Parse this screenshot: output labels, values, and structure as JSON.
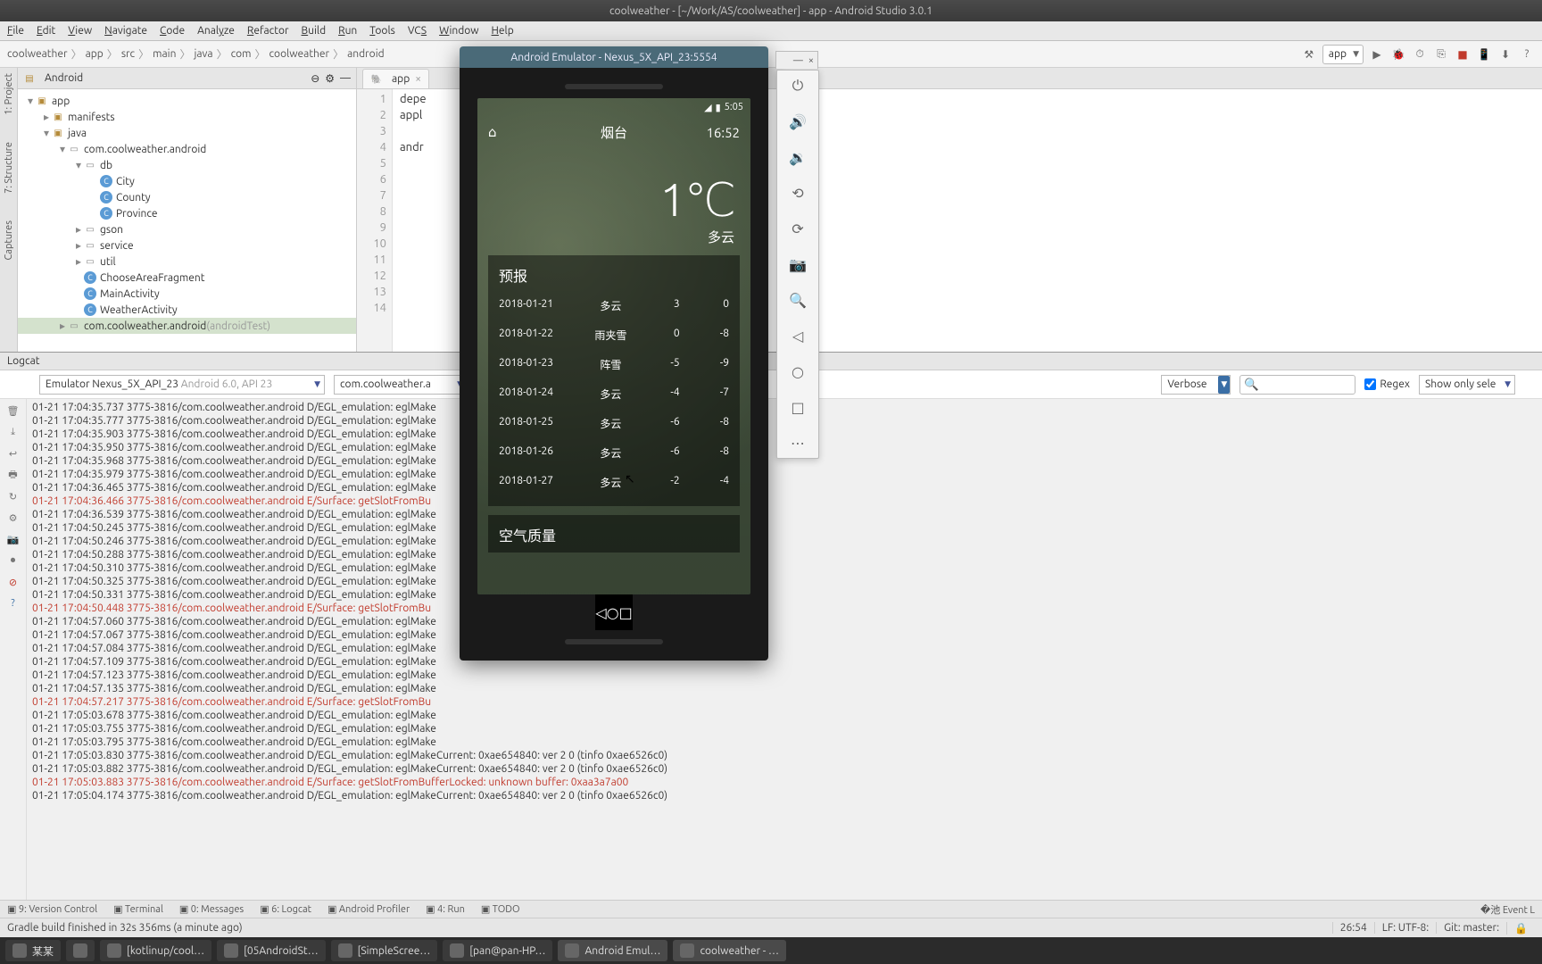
{
  "window_title": "coolweather - [~/Work/AS/coolweather] - app - Android Studio 3.0.1",
  "menu": [
    "File",
    "Edit",
    "View",
    "Navigate",
    "Code",
    "Analyze",
    "Refactor",
    "Build",
    "Run",
    "Tools",
    "VCS",
    "Window",
    "Help"
  ],
  "menu_mnemonic_index": [
    0,
    0,
    0,
    0,
    0,
    4,
    0,
    0,
    0,
    0,
    2,
    0,
    0
  ],
  "breadcrumbs": [
    "coolweather",
    "app",
    "src",
    "main",
    "java",
    "com",
    "coolweather",
    "android"
  ],
  "run_config": "app",
  "proj_scope": "Android",
  "project_tree": [
    {
      "d": 0,
      "t": "app",
      "tw": "▾",
      "ic": "fold"
    },
    {
      "d": 1,
      "t": "manifests",
      "tw": "▸",
      "ic": "fold"
    },
    {
      "d": 1,
      "t": "java",
      "tw": "▾",
      "ic": "fold"
    },
    {
      "d": 2,
      "t": "com.coolweather.android",
      "tw": "▾",
      "ic": "pkg"
    },
    {
      "d": 3,
      "t": "db",
      "tw": "▾",
      "ic": "pkg"
    },
    {
      "d": 4,
      "t": "City",
      "tw": " ",
      "ic": "cls"
    },
    {
      "d": 4,
      "t": "County",
      "tw": " ",
      "ic": "cls"
    },
    {
      "d": 4,
      "t": "Province",
      "tw": " ",
      "ic": "cls"
    },
    {
      "d": 3,
      "t": "gson",
      "tw": "▸",
      "ic": "pkg"
    },
    {
      "d": 3,
      "t": "service",
      "tw": "▸",
      "ic": "pkg"
    },
    {
      "d": 3,
      "t": "util",
      "tw": "▸",
      "ic": "pkg"
    },
    {
      "d": 3,
      "t": "ChooseAreaFragment",
      "tw": " ",
      "ic": "cls"
    },
    {
      "d": 3,
      "t": "MainActivity",
      "tw": " ",
      "ic": "cls"
    },
    {
      "d": 3,
      "t": "WeatherActivity",
      "tw": " ",
      "ic": "cls"
    },
    {
      "d": 2,
      "t": "com.coolweather.android",
      "suff": " (androidTest)",
      "tw": "▸",
      "ic": "pkg",
      "sel": true
    }
  ],
  "editor_tab": "app",
  "gutter_lines": [
    "1",
    "2",
    "3",
    "4",
    "5",
    "6",
    "7",
    "8",
    "9",
    "10",
    "11",
    "12",
    "13",
    "14"
  ],
  "src_lines": [
    "depe",
    "appl",
    "",
    "andr",
    "",
    "",
    "",
    "",
    "",
    "",
    "",
    "",
    "",
    ""
  ],
  "logcat_label": "Logcat",
  "logcat_device": "Emulator Nexus_5X_API_23",
  "logcat_device_suffix": "Android 6.0, API 23",
  "logcat_process": "com.coolweather.a",
  "logcat_level": "Verbose",
  "logcat_search_placeholder": "",
  "logcat_regex": "Regex",
  "logcat_filter": "Show only sele",
  "log_lines": [
    {
      "t": "01-21 17:04:35.737 3775-3816/com.coolweather.android D/EGL_emulation: eglMake"
    },
    {
      "t": "01-21 17:04:35.777 3775-3816/com.coolweather.android D/EGL_emulation: eglMake"
    },
    {
      "t": "01-21 17:04:35.903 3775-3816/com.coolweather.android D/EGL_emulation: eglMake"
    },
    {
      "t": "01-21 17:04:35.950 3775-3816/com.coolweather.android D/EGL_emulation: eglMake"
    },
    {
      "t": "01-21 17:04:35.968 3775-3816/com.coolweather.android D/EGL_emulation: eglMake"
    },
    {
      "t": "01-21 17:04:35.979 3775-3816/com.coolweather.android D/EGL_emulation: eglMake"
    },
    {
      "t": "01-21 17:04:36.465 3775-3816/com.coolweather.android D/EGL_emulation: eglMake"
    },
    {
      "t": "01-21 17:04:36.466 3775-3816/com.coolweather.android E/Surface: getSlotFromBu",
      "err": true
    },
    {
      "t": "01-21 17:04:36.539 3775-3816/com.coolweather.android D/EGL_emulation: eglMake"
    },
    {
      "t": "01-21 17:04:50.245 3775-3816/com.coolweather.android D/EGL_emulation: eglMake"
    },
    {
      "t": "01-21 17:04:50.246 3775-3816/com.coolweather.android D/EGL_emulation: eglMake"
    },
    {
      "t": "01-21 17:04:50.288 3775-3816/com.coolweather.android D/EGL_emulation: eglMake"
    },
    {
      "t": "01-21 17:04:50.310 3775-3816/com.coolweather.android D/EGL_emulation: eglMake"
    },
    {
      "t": "01-21 17:04:50.325 3775-3816/com.coolweather.android D/EGL_emulation: eglMake"
    },
    {
      "t": "01-21 17:04:50.331 3775-3816/com.coolweather.android D/EGL_emulation: eglMake"
    },
    {
      "t": "01-21 17:04:50.448 3775-3816/com.coolweather.android E/Surface: getSlotFromBu",
      "err": true
    },
    {
      "t": "01-21 17:04:57.060 3775-3816/com.coolweather.android D/EGL_emulation: eglMake"
    },
    {
      "t": "01-21 17:04:57.067 3775-3816/com.coolweather.android D/EGL_emulation: eglMake"
    },
    {
      "t": "01-21 17:04:57.084 3775-3816/com.coolweather.android D/EGL_emulation: eglMake"
    },
    {
      "t": "01-21 17:04:57.109 3775-3816/com.coolweather.android D/EGL_emulation: eglMake"
    },
    {
      "t": "01-21 17:04:57.123 3775-3816/com.coolweather.android D/EGL_emulation: eglMake"
    },
    {
      "t": "01-21 17:04:57.135 3775-3816/com.coolweather.android D/EGL_emulation: eglMake"
    },
    {
      "t": "01-21 17:04:57.217 3775-3816/com.coolweather.android E/Surface: getSlotFromBu",
      "err": true
    },
    {
      "t": "01-21 17:05:03.678 3775-3816/com.coolweather.android D/EGL_emulation: eglMake"
    },
    {
      "t": "01-21 17:05:03.755 3775-3816/com.coolweather.android D/EGL_emulation: eglMake"
    },
    {
      "t": "01-21 17:05:03.795 3775-3816/com.coolweather.android D/EGL_emulation: eglMake"
    },
    {
      "t": "01-21 17:05:03.830 3775-3816/com.coolweather.android D/EGL_emulation: eglMakeCurrent: 0xae654840: ver 2 0 (tinfo 0xae6526c0)"
    },
    {
      "t": "01-21 17:05:03.882 3775-3816/com.coolweather.android D/EGL_emulation: eglMakeCurrent: 0xae654840: ver 2 0 (tinfo 0xae6526c0)"
    },
    {
      "t": "01-21 17:05:03.883 3775-3816/com.coolweather.android E/Surface: getSlotFromBufferLocked: unknown buffer: 0xaa3a7a00",
      "err": true
    },
    {
      "t": "01-21 17:05:04.174 3775-3816/com.coolweather.android D/EGL_emulation: eglMakeCurrent: 0xae654840: ver 2 0 (tinfo 0xae6526c0)"
    }
  ],
  "bottom_tools": [
    "9: Version Control",
    "Terminal",
    "0: Messages",
    "6: Logcat",
    "Android Profiler",
    "4: Run",
    "TODO"
  ],
  "bottom_right": "Event L",
  "status_msg": "Gradle build finished in 32s 356ms (a minute ago)",
  "status_pos": "26:54",
  "status_enc": "LF: UTF-8:",
  "status_git": "Git: master:",
  "emu_title": "Android Emulator - Nexus_5X_API_23:5554",
  "phone": {
    "status_time": "5:05",
    "city": "烟台",
    "local_time": "16:52",
    "temp": "1℃",
    "cond": "多云",
    "forecast_title": "预报",
    "aqi_title": "空气质量",
    "days": [
      {
        "d": "2018-01-21",
        "c": "多云",
        "h": "3",
        "l": "0"
      },
      {
        "d": "2018-01-22",
        "c": "雨夹雪",
        "h": "0",
        "l": "-8"
      },
      {
        "d": "2018-01-23",
        "c": "阵雪",
        "h": "-5",
        "l": "-9"
      },
      {
        "d": "2018-01-24",
        "c": "多云",
        "h": "-4",
        "l": "-7"
      },
      {
        "d": "2018-01-25",
        "c": "多云",
        "h": "-6",
        "l": "-8"
      },
      {
        "d": "2018-01-26",
        "c": "多云",
        "h": "-6",
        "l": "-8"
      },
      {
        "d": "2018-01-27",
        "c": "多云",
        "h": "-2",
        "l": "-4"
      }
    ]
  },
  "os_tasks": [
    "某某",
    "",
    "[kotlinup/cool…",
    "[05AndroidSt…",
    "[SimpleScree…",
    "[pan@pan-HP…",
    "Android Emul…",
    "coolweather - …"
  ]
}
